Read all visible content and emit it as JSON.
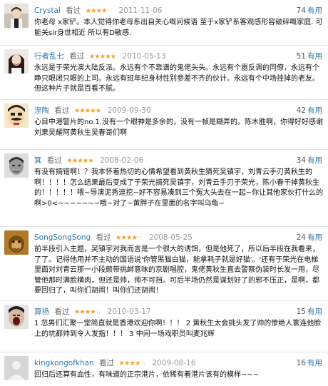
{
  "useful_label": "有用",
  "watched_label": "看过",
  "reviews": [
    {
      "user": "Crystal",
      "stars": "★★★★",
      "stars_off": "☆",
      "date": "2011-11-06",
      "useful": "74",
      "avatar_icon": "avatar-girl-photo",
      "text": "你老母 x家铲。本人觉得你老母系出自关心嘅问候语 至于x家铲系客观感形容破碎嘅家庭. 可能关sir身世相近 所以有D敏感."
    },
    {
      "user": "行者乱七",
      "stars": "★★★★★",
      "stars_off": "",
      "date": "2010-05-13",
      "useful": "51",
      "avatar_icon": "avatar-woman-photo",
      "text": "永远是于荣光演大陆反派。永远有个不靠谱的鬼佬头头。永远有个嚣反调的同僚，永远有个睁只眼闭只眼的上司。永远有班年纪身材性别参差不齐的伙计。永远有个中场挂掉的老友。但这种片子就是百看不腻。"
    },
    {
      "user": "涅陶",
      "stars": "★★★★★",
      "stars_off": "",
      "date": "2009-09-30",
      "useful": "42",
      "avatar_icon": "avatar-cartoon-mustache",
      "text": "心目中港警片的no.1.没有一个眼神是多余的，没有一帧是糊弄的。陈木胜啊，你得好好感谢刘果吴耀阿黄秋生吴春哥们啊"
    },
    {
      "user": "箕",
      "stars": "★★★★★",
      "stars_off": "",
      "date": "2008-02-06",
      "useful": "34",
      "avatar_icon": "avatar-bw-face",
      "text": "有没有搞错啊！？我本怀着热切的心情希望看到黄秋生猜死吴镇宇，刘青云手刃黄秋生的啊！！！！怎么结果最后变成了于荣光搞死吴镇宇，刘青云手刃于荣光，陈小春干掉黄秋生的！！！！！喂~导演泥秀逗挖~好不容易凑到三个冤大头去在一起~你让其他家伙打什么的啊>0<~~~~~~~哦~对了~黄胖子在里面的名字叫乌龟~"
    },
    {
      "user": "SongSongSong",
      "stars": "★★★★",
      "stars_off": "☆",
      "date": "2008-05-25",
      "useful": "24",
      "avatar_icon": "avatar-monkey-face",
      "text": "前半段引入主题，吴镇宇对我而言是一个很大的诱饵，但是他死了，所以后半段在我看来，了了。记得他用并不主动的国语说'你管黑猫白猫，能拿耗子就是好猫'。'还有于荣光在电梯里面对刘青云那一小段颇带挑衅意味的京剧唱腔，鬼佬黄秋生直去警察伪装时长发一甩，尽管他那时满脸横肉，但还是帅，帅不可挡。可后半场仍然是谋划好了的邪不压正，是啊，都要回归了，叫你们胡闹！叫你们还胡闹！"
    },
    {
      "user": "算扬",
      "stars": "★★★★",
      "stars_off": "☆",
      "date": "2010-03-17",
      "useful": "15",
      "avatar_icon": "avatar-screaming-face",
      "text": "1 忽男们汇聚一堂简直就是香港欢迎你啊！！！ 2 黄秋生太会挑头发了帅的惨绝人寰连他脸上的坑都帅到令人发指！！！ 3 中间一场戏职员叫麦兆辉"
    },
    {
      "user": "kingkongofkhan",
      "stars": "★★★★",
      "stars_off": "☆",
      "date": "2009-08-16",
      "useful": "16",
      "avatar_icon": "avatar-blank-gray",
      "text": "回归后还算有血性，有味道的正宗港片，依稀有着港片该有的模样~~~"
    }
  ]
}
